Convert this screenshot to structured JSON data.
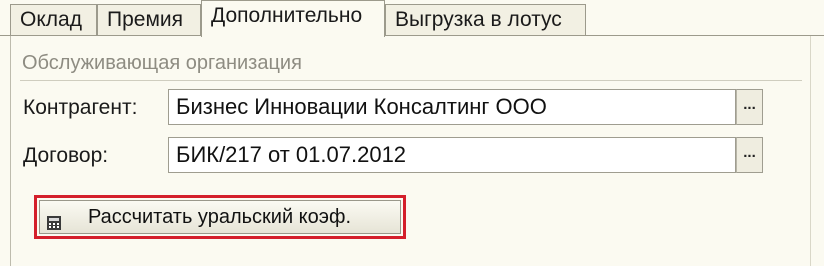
{
  "tabs": [
    {
      "label": "Оклад"
    },
    {
      "label": "Премия"
    },
    {
      "label": "Дополнительно",
      "active": true
    },
    {
      "label": "Выгрузка в лотус"
    }
  ],
  "group": {
    "title": "Обслуживающая организация"
  },
  "fields": {
    "counterparty": {
      "label": "Контрагент:",
      "value": "Бизнес Инновации Консалтинг ООО",
      "select_label": "..."
    },
    "contract": {
      "label": "Договор:",
      "value": "БИК/217 от 01.07.2012",
      "select_label": "..."
    }
  },
  "action": {
    "label": "Рассчитать уральский коэф.",
    "icon": "calculator-icon",
    "highlight_color": "#d41f2b"
  }
}
